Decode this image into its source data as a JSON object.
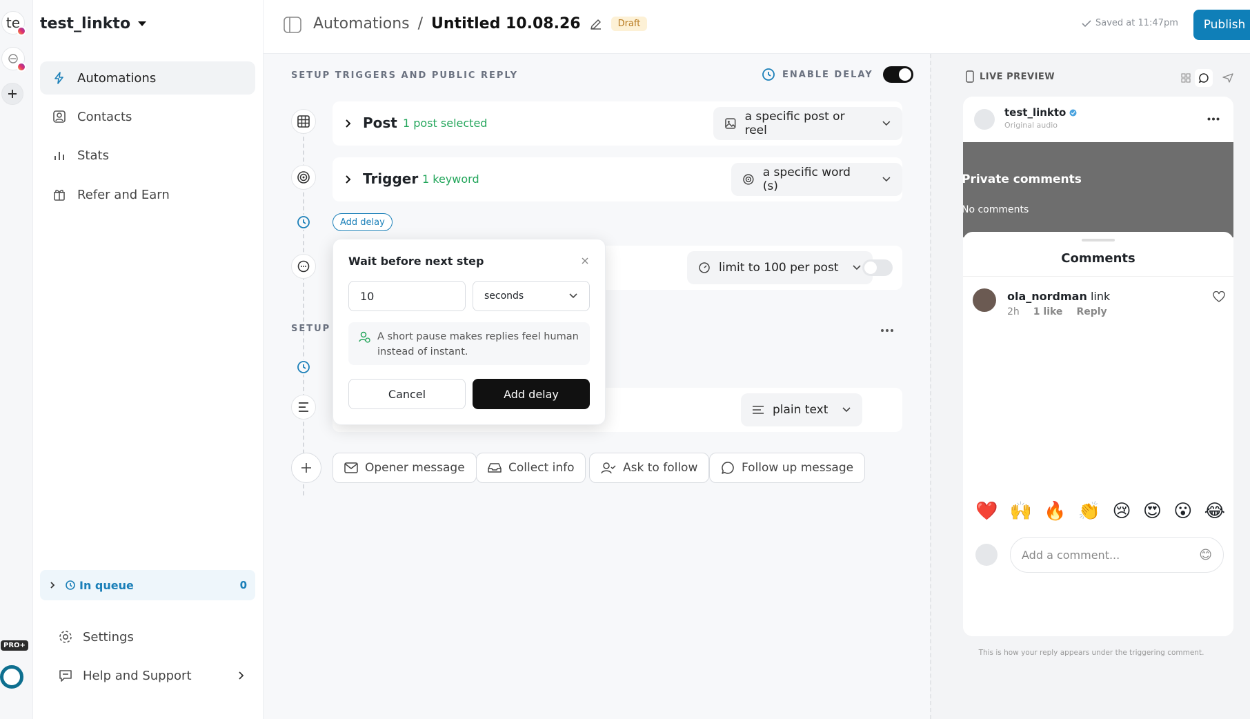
{
  "rail": {
    "account1_initials": "te",
    "pro_badge": "PRO+"
  },
  "sidebar": {
    "account_name": "test_linkto",
    "items": [
      {
        "label": "Automations",
        "icon": "bolt-icon"
      },
      {
        "label": "Contacts",
        "icon": "contact-icon"
      },
      {
        "label": "Stats",
        "icon": "bar-chart-icon"
      },
      {
        "label": "Refer and Earn",
        "icon": "gift-icon"
      }
    ],
    "queue": {
      "label": "In queue",
      "count": "0"
    },
    "settings": "Settings",
    "help": "Help and Support"
  },
  "header": {
    "breadcrumb_root": "Automations",
    "separator": "/",
    "title": "Untitled 10.08.26",
    "status": "Draft",
    "saved": "Saved at 11:47pm",
    "publish": "Publish"
  },
  "builder": {
    "section1": "SETUP TRIGGERS AND PUBLIC REPLY",
    "enable_delay": "ENABLE DELAY",
    "enable_delay_on": true,
    "post": {
      "title": "Post",
      "summary": "1 post selected",
      "dropdown": "a specific post or reel"
    },
    "trigger": {
      "title": "Trigger",
      "summary": "1 keyword",
      "dropdown": "a specific word (s)"
    },
    "add_delay_chip": "Add delay",
    "reply": {
      "dropdown": "limit to 100 per post",
      "toggle_on": false
    },
    "section2_partial": "SETUP D",
    "message": {
      "dropdown": "plain text"
    },
    "chips": [
      "Opener message",
      "Collect info",
      "Ask to follow",
      "Follow up message"
    ]
  },
  "popover": {
    "title": "Wait before next step",
    "value": "10",
    "unit": "seconds",
    "hint": "A short pause makes replies feel human instead of instant.",
    "cancel": "Cancel",
    "confirm": "Add delay"
  },
  "preview": {
    "label": "LIVE PREVIEW",
    "username": "test_linkto",
    "audio": "Original audio",
    "private_comments": "Private comments",
    "no_comments": "No comments",
    "comments_title": "Comments",
    "comment": {
      "user": "ola_nordman",
      "text": "link",
      "time": "2h",
      "likes": "1 like",
      "reply": "Reply"
    },
    "emojis": [
      "❤️",
      "🙌",
      "🔥",
      "👏",
      "😢",
      "😍",
      "😮",
      "😂"
    ],
    "add_comment_placeholder": "Add a comment...",
    "smile": "😊",
    "footer": "This is how your reply appears under the triggering comment."
  },
  "colors": {
    "accent": "#0f7fb8",
    "green": "#22a55a",
    "draft_bg": "#fdf1d6",
    "draft_text": "#b7791f",
    "dark": "#111111"
  }
}
